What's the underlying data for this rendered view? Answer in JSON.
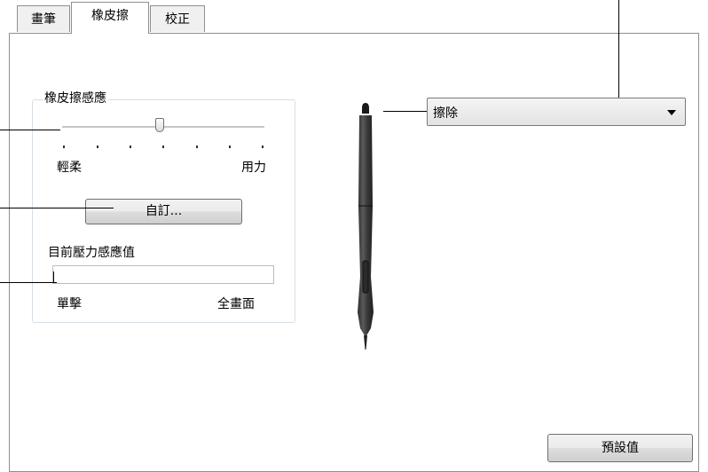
{
  "tabs": [
    {
      "label": "畫筆"
    },
    {
      "label": "橡皮擦"
    },
    {
      "label": "校正"
    }
  ],
  "eraser_feel": {
    "group_title": "橡皮擦感應",
    "slider_value": 0.48,
    "min_label": "輕柔",
    "max_label": "用力",
    "customize_label": "自訂..."
  },
  "pressure": {
    "title": "目前壓力感應值",
    "value": 0,
    "min_label": "單擊",
    "max_label": "全畫面"
  },
  "eraser_button": {
    "selected": "擦除"
  },
  "default_button": {
    "label": "預設值"
  }
}
